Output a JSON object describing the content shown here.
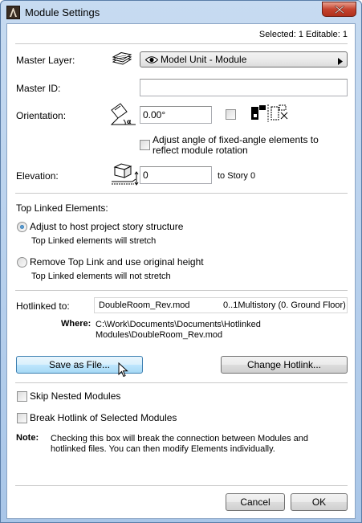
{
  "window": {
    "title": "Module Settings",
    "accent": "#c5432e"
  },
  "status": {
    "selection": "Selected: 1 Editable: 1"
  },
  "master_layer": {
    "label": "Master Layer:",
    "value": "Model Unit - Module"
  },
  "master_id": {
    "label": "Master ID:",
    "value": ""
  },
  "orientation": {
    "label": "Orientation:",
    "value": "0.00°",
    "adjust_label": "Adjust angle of fixed-angle elements to reflect module rotation"
  },
  "elevation": {
    "label": "Elevation:",
    "value": "0",
    "relative_to": "to Story 0"
  },
  "top_linked": {
    "heading": "Top Linked Elements:",
    "option1": {
      "label": "Adjust to host project story structure",
      "note": "Top Linked elements will stretch",
      "selected": true
    },
    "option2": {
      "label": "Remove Top Link and use original height",
      "note": "Top Linked elements will not stretch",
      "selected": false
    }
  },
  "hotlink": {
    "label": "Hotlinked to:",
    "file": "DoubleRoom_Rev.mod",
    "story": "0..1Multistory (0. Ground Floor)",
    "where_label": "Where:",
    "where_line1": "C:\\Work\\Documents\\Documents\\Hotlinked",
    "where_line2": "Modules\\DoubleRoom_Rev.mod"
  },
  "buttons": {
    "save_as_file": "Save as File...",
    "change_hotlink": "Change Hotlink...",
    "cancel": "Cancel",
    "ok": "OK"
  },
  "options": {
    "skip_nested": "Skip Nested Modules",
    "break_hotlink": "Break Hotlink of Selected Modules"
  },
  "note": {
    "label": "Note:",
    "line1": "Checking this box will break the connection between Modules and",
    "line2": "hotlinked files. You can then modify Elements individually."
  }
}
